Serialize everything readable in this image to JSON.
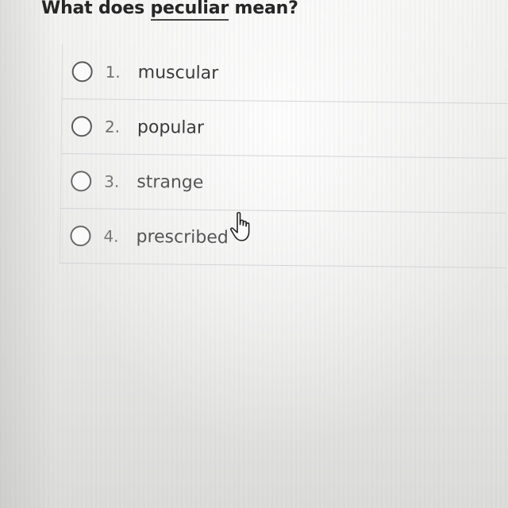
{
  "question": {
    "prefix": "What does ",
    "keyword": "peculiar",
    "suffix": " mean?"
  },
  "options": [
    {
      "number": "1.",
      "text": "muscular"
    },
    {
      "number": "2.",
      "text": "popular"
    },
    {
      "number": "3.",
      "text": "strange"
    },
    {
      "number": "4.",
      "text": "prescribed"
    }
  ],
  "icons": {
    "radio": "radio-unselected-icon",
    "pointer": "hand-pointer-cursor-icon"
  },
  "colors": {
    "text": "#262626",
    "radio_border": "#5a5a5a",
    "divider": "#d2d4d6"
  }
}
